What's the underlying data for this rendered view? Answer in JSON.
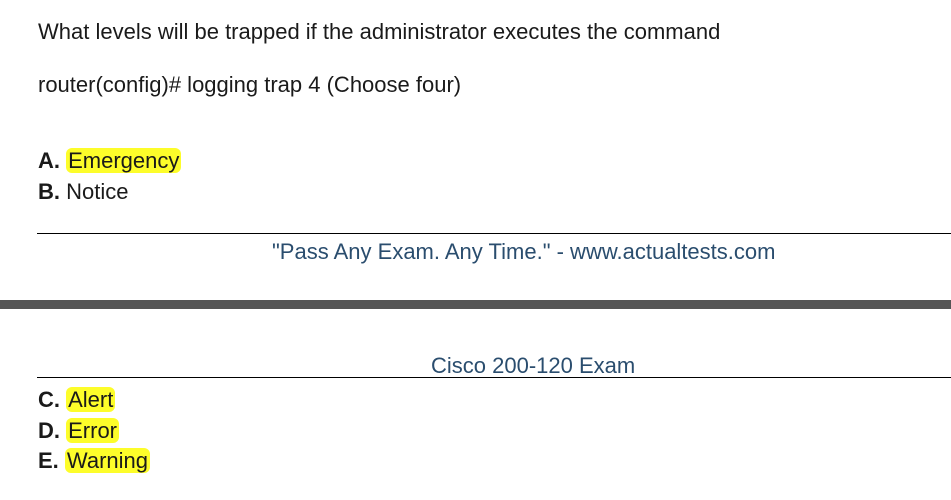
{
  "question": {
    "line1": "What levels will be trapped if the administrator executes the command",
    "line2": "router(config)# logging trap 4 (Choose four)"
  },
  "options": [
    {
      "letter": "A.",
      "text": "Emergency",
      "highlighted": true
    },
    {
      "letter": "B.",
      "text": "Notice",
      "highlighted": false
    },
    {
      "letter": "C.",
      "text": "Alert",
      "highlighted": true
    },
    {
      "letter": "D.",
      "text": "Error",
      "highlighted": true
    },
    {
      "letter": "E.",
      "text": "Warning",
      "highlighted": true
    }
  ],
  "page_footer": {
    "text": "\"Pass Any Exam. Any Time.\" - www.actualtests.com"
  },
  "page_header": {
    "text": "Cisco 200-120 Exam"
  },
  "colors": {
    "highlight": "#fdfd2a",
    "header_footer_text": "#2a4d6e",
    "page_break": "#555555"
  }
}
